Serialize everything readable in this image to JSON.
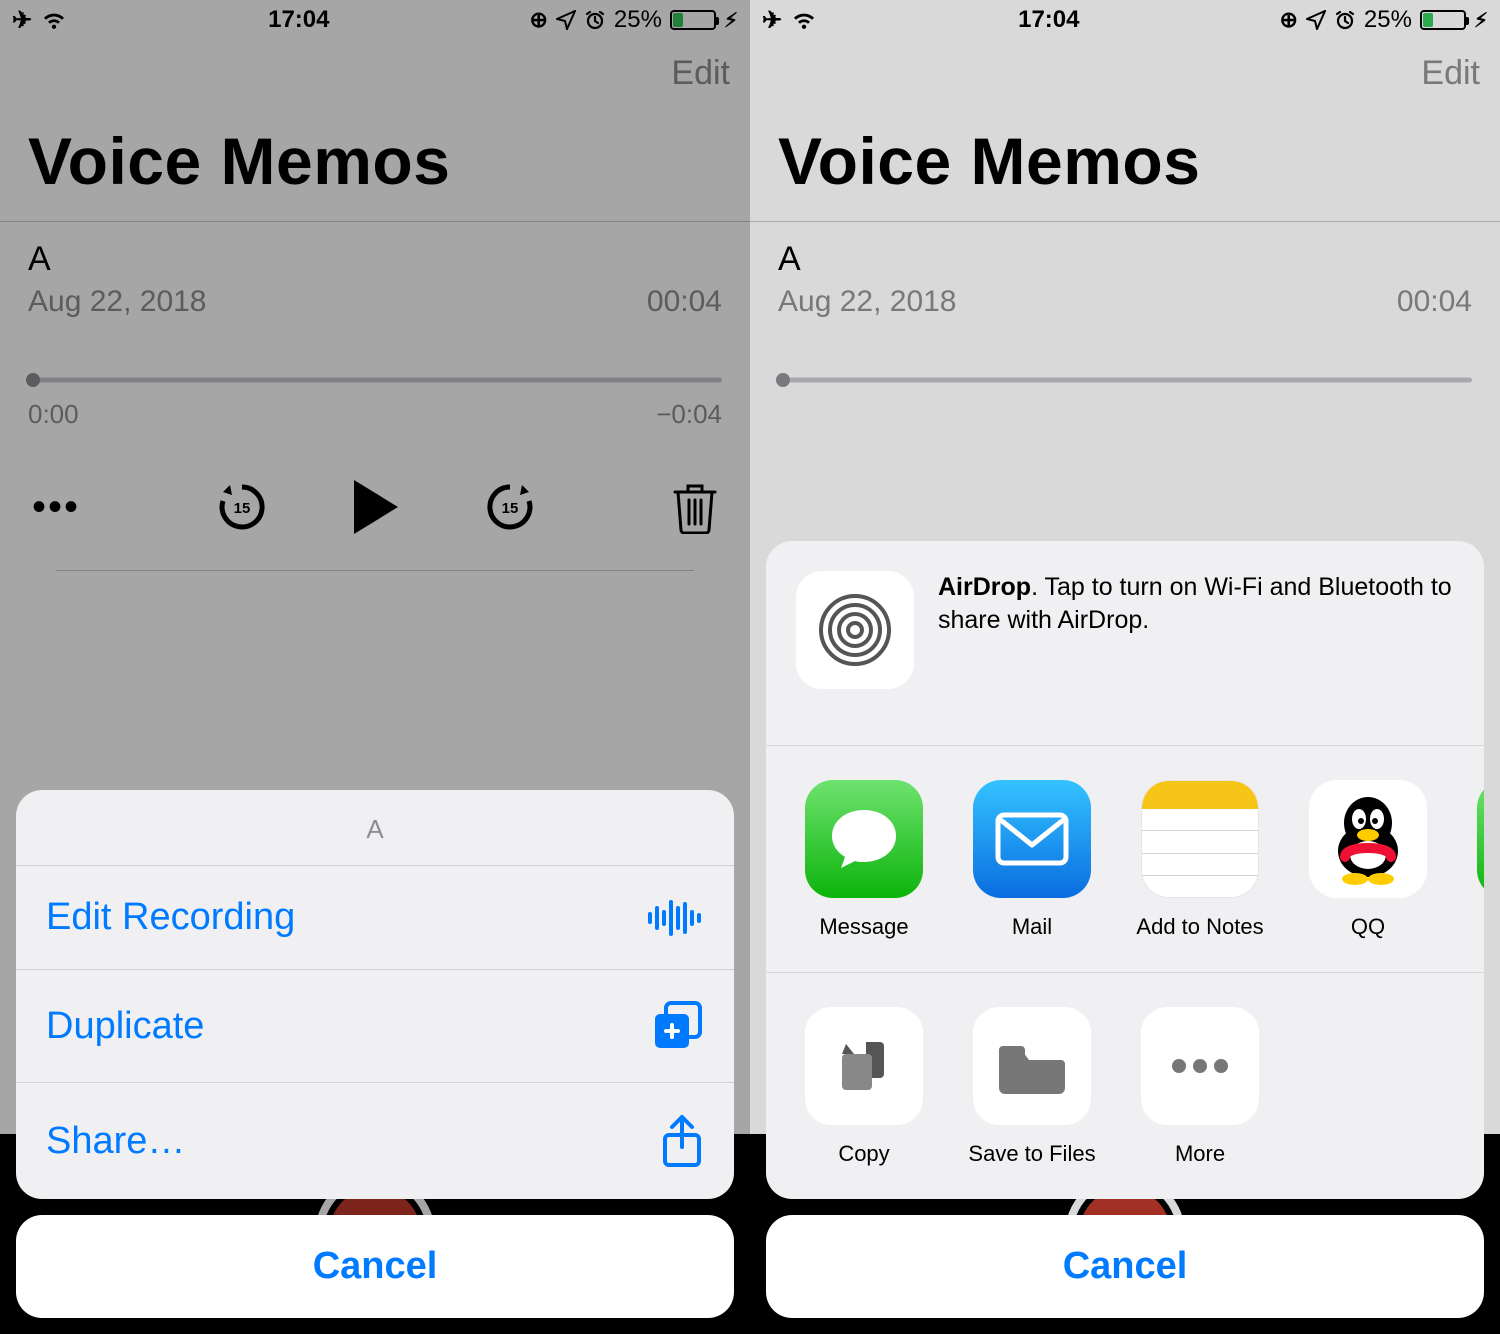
{
  "status": {
    "time": "17:04",
    "battery_pct": "25%"
  },
  "nav": {
    "edit": "Edit"
  },
  "title": "Voice Memos",
  "memo": {
    "name": "A",
    "date": "Aug 22, 2018",
    "duration": "00:04",
    "elapsed": "0:00",
    "remaining": "−0:04"
  },
  "action_sheet": {
    "title": "A",
    "items": [
      {
        "label": "Edit Recording",
        "icon": "waveform"
      },
      {
        "label": "Duplicate",
        "icon": "duplicate"
      },
      {
        "label": "Share…",
        "icon": "share"
      }
    ],
    "cancel": "Cancel"
  },
  "share_sheet": {
    "airdrop_bold": "AirDrop",
    "airdrop_text": ". Tap to turn on Wi-Fi and Bluetooth to share with AirDrop.",
    "apps": [
      {
        "label": "Message",
        "kind": "message"
      },
      {
        "label": "Mail",
        "kind": "mail"
      },
      {
        "label": "Add to Notes",
        "kind": "notes"
      },
      {
        "label": "QQ",
        "kind": "qq"
      }
    ],
    "actions": [
      {
        "label": "Copy",
        "kind": "copy"
      },
      {
        "label": "Save to Files",
        "kind": "files"
      },
      {
        "label": "More",
        "kind": "more"
      }
    ],
    "cancel": "Cancel"
  }
}
